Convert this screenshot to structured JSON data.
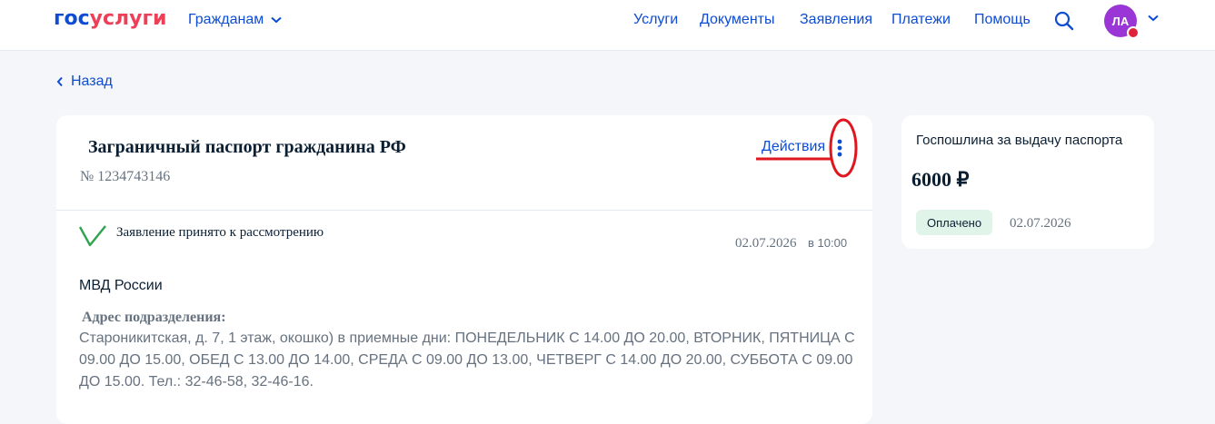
{
  "header": {
    "logo": {
      "part1": "гос",
      "part2": "услуги"
    },
    "citizens_label": "Гражданам",
    "nav": [
      "Услуги",
      "Документы",
      "Заявления",
      "Платежи",
      "Помощь"
    ],
    "avatar_initials": "ЛА",
    "icons": {
      "search": "search-icon",
      "chevron": "chevron-down-icon"
    }
  },
  "back_label": "Назад",
  "application": {
    "title": "Заграничный паспорт гражданина РФ",
    "number": "№ 1234743146",
    "actions_label": "Действия",
    "status": {
      "text": "Заявление принято к рассмотрению",
      "date": "02.07.2026",
      "time": "в 10:00",
      "icon": "check-icon"
    },
    "organization": "МВД России",
    "address_label": "Адрес подразделения:",
    "address_text": "Староникитская, д. 7, 1 этаж, окошко) в приемные дни: ПОНЕДЕЛЬНИК С 14.00 ДО 20.00, ВТОРНИК, ПЯТНИЦА С 09.00 ДО 15.00, ОБЕД С 13.00 ДО 14.00, СРЕДА С 09.00 ДО 13.00, ЧЕТВЕРГ С 14.00 ДО 20.00, СУББОТА С 09.00 ДО 15.00. Тел.: 32-46-58, 32-46-16."
  },
  "fee": {
    "title": "Госпошлина за выдачу паспорта",
    "amount": "6000 ₽",
    "status": "Оплачено",
    "date": "02.07.2026"
  },
  "colors": {
    "brand_blue": "#0d4cd3",
    "brand_red": "#ee3f58",
    "avatar": "#9b36d6",
    "annotation_red": "#e0161f",
    "check_green": "#2ea44f",
    "paid_badge": "#e1f4ea"
  }
}
